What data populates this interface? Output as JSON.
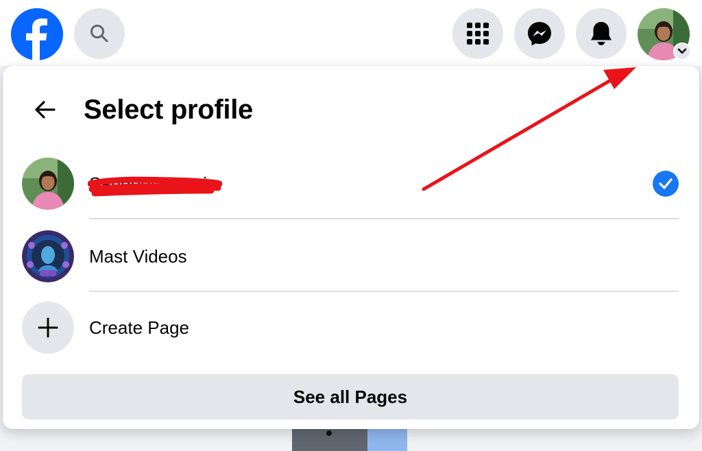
{
  "topbar": {
    "logo_icon": "facebook-logo-icon",
    "search_icon": "search-icon",
    "menu_icon": "grid-menu-icon",
    "messenger_icon": "messenger-icon",
    "notifications_icon": "bell-icon",
    "account_icon": "avatar",
    "account_caret_icon": "chevron-down-icon"
  },
  "panel": {
    "back_icon": "arrow-left-icon",
    "title": "Select profile",
    "profiles": [
      {
        "label": "Sangeeta Rani",
        "selected": true,
        "avatar": "avatar"
      },
      {
        "label": "Mast Videos",
        "selected": false,
        "avatar": "page-avatar"
      }
    ],
    "create_label": "Create Page",
    "create_icon": "plus-icon",
    "see_all_label": "See all Pages"
  },
  "colors": {
    "brand": "#0866ff",
    "check": "#1877f2",
    "button_bg": "#e4e6eb",
    "annotation": "#e8141a"
  }
}
